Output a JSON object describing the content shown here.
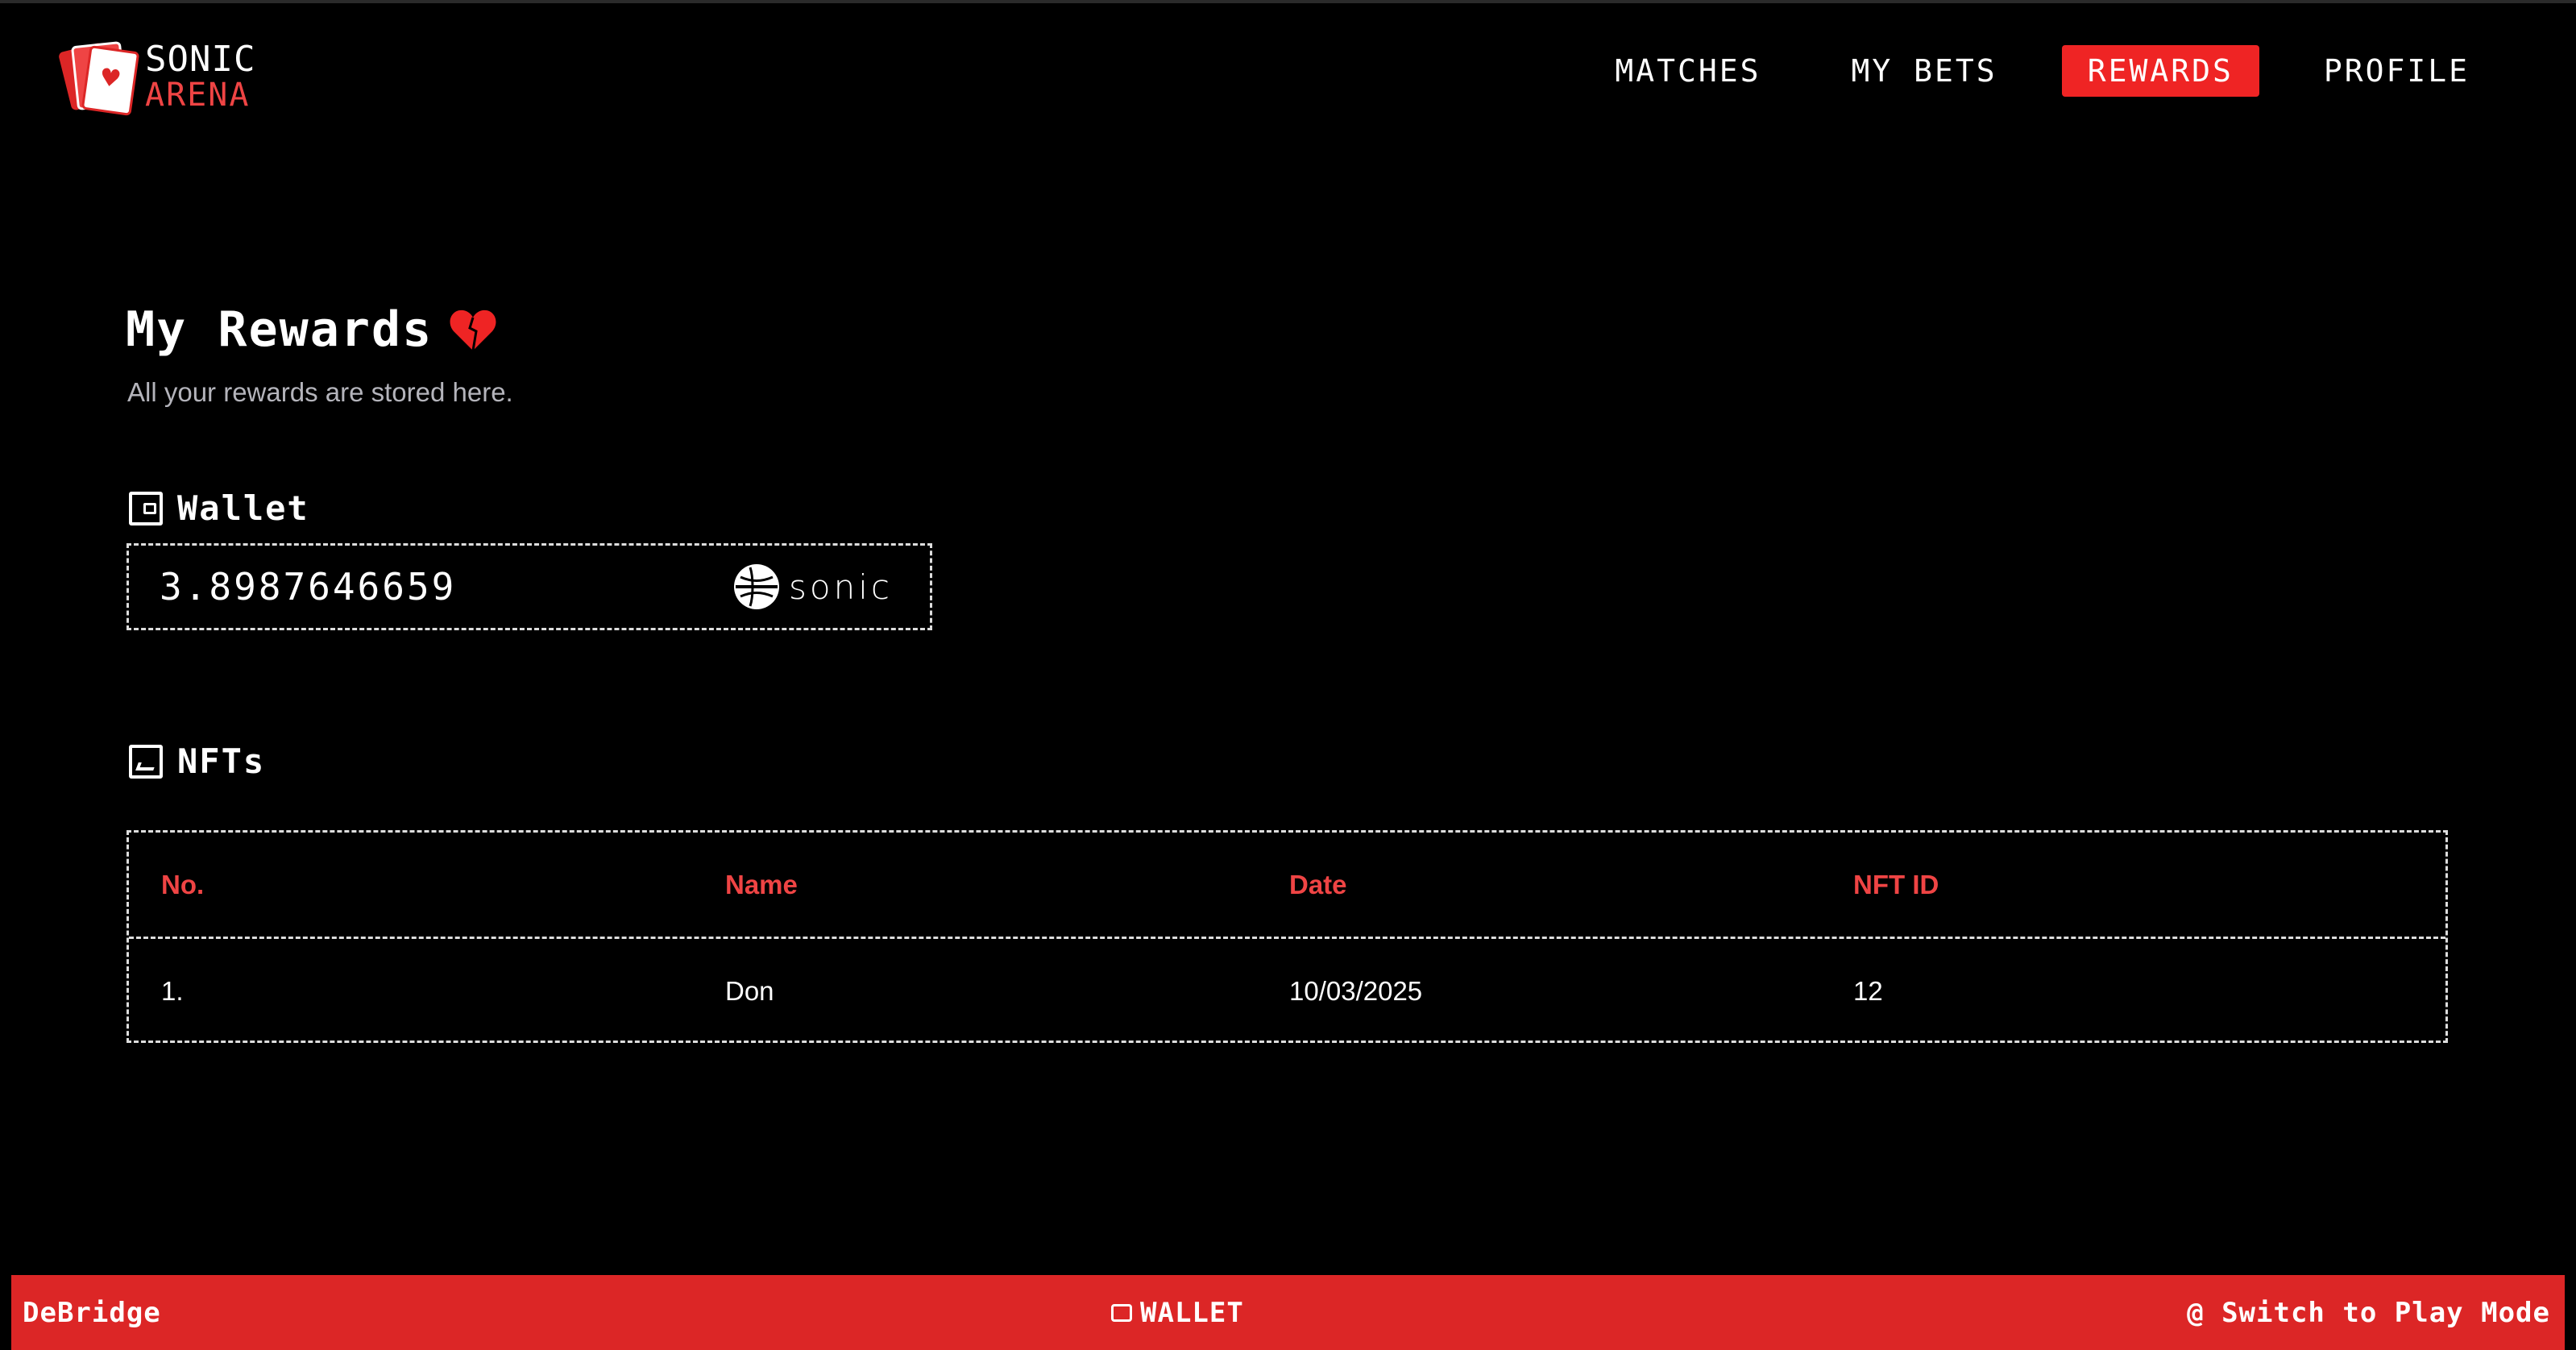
{
  "brand": {
    "line1": "SONIC",
    "line2": "ARENA",
    "accent_color": "#ef4444"
  },
  "nav": {
    "items": [
      {
        "label": "MATCHES",
        "active": false
      },
      {
        "label": "MY BETS",
        "active": false
      },
      {
        "label": "REWARDS",
        "active": true
      },
      {
        "label": "PROFILE",
        "active": false
      }
    ]
  },
  "page": {
    "title": "My Rewards",
    "title_icon": "heart-icon",
    "subtitle": "All your rewards are stored here."
  },
  "wallet": {
    "heading": "Wallet",
    "heading_icon": "wallet-icon",
    "balance": "3.8987646659",
    "token_label": "SONIC",
    "token_icon": "sonic-logo-icon"
  },
  "nfts": {
    "heading": "NFTs",
    "heading_icon": "image-icon",
    "columns": [
      "No.",
      "Name",
      "Date",
      "NFT ID"
    ],
    "rows": [
      [
        "1.",
        "Don",
        "10/03/2025",
        "12"
      ]
    ]
  },
  "footer": {
    "left": "DeBridge",
    "center": "WALLET",
    "right": "@ Switch to Play Mode",
    "background": "#dc2626"
  }
}
